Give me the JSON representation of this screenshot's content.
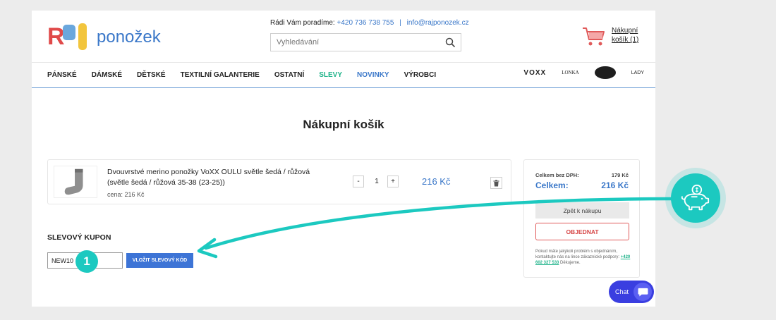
{
  "logo": {
    "letters": "Ráj",
    "word": "ponožek"
  },
  "header": {
    "contact_label": "Rádi Vám poradíme:",
    "phone": "+420 736 738 755",
    "separator": "|",
    "email": "info@rajponozek.cz",
    "search_placeholder": "Vyhledávání",
    "cart_line1": "Nákupní",
    "cart_line2": "košík (1)"
  },
  "nav": {
    "items": [
      "PÁNSKÉ",
      "DÁMSKÉ",
      "DĚTSKÉ",
      "TEXTILNÍ GALANTERIE",
      "OSTATNÍ",
      "SLEVY",
      "NOVINKY",
      "VÝROBCI"
    ],
    "brands": [
      "VOXX",
      "LONKA",
      "LADY"
    ]
  },
  "page": {
    "title": "Nákupní košík"
  },
  "item": {
    "name": "Dvouvrstvé merino ponožky VoXX OULU světle šedá / růžová (světle šedá / růžová 35-38 (23-25))",
    "unit_price": "cena: 216 Kč",
    "minus": "-",
    "plus": "+",
    "quantity": "1",
    "total": "216 Kč"
  },
  "summary": {
    "without_vat_label": "Celkem bez DPH:",
    "without_vat_value": "179 Kč",
    "total_label": "Celkem:",
    "total_value": "216 Kč",
    "back_button": "Zpět k nákupu",
    "order_button": "OBJEDNAT",
    "help_text": "Pokud máte jakýkoli problém s objednáním, kontaktujte nás na lince zákaznické podpory:",
    "help_phone": "+420 602 327 533",
    "help_thanks": "Děkujeme."
  },
  "coupon": {
    "title": "SLEVOVÝ KUPON",
    "value": "NEW10",
    "button": "VLOŽIT SLEVOVÝ KÓD"
  },
  "chat": {
    "label": "Chat"
  },
  "annotation": {
    "step": "1"
  },
  "colors": {
    "accent_blue": "#3b78c9",
    "sale_green": "#1fb38a",
    "order_red": "#d64444",
    "annotation_teal": "#1cc9c0",
    "chat_purple": "#3a3ee0"
  }
}
